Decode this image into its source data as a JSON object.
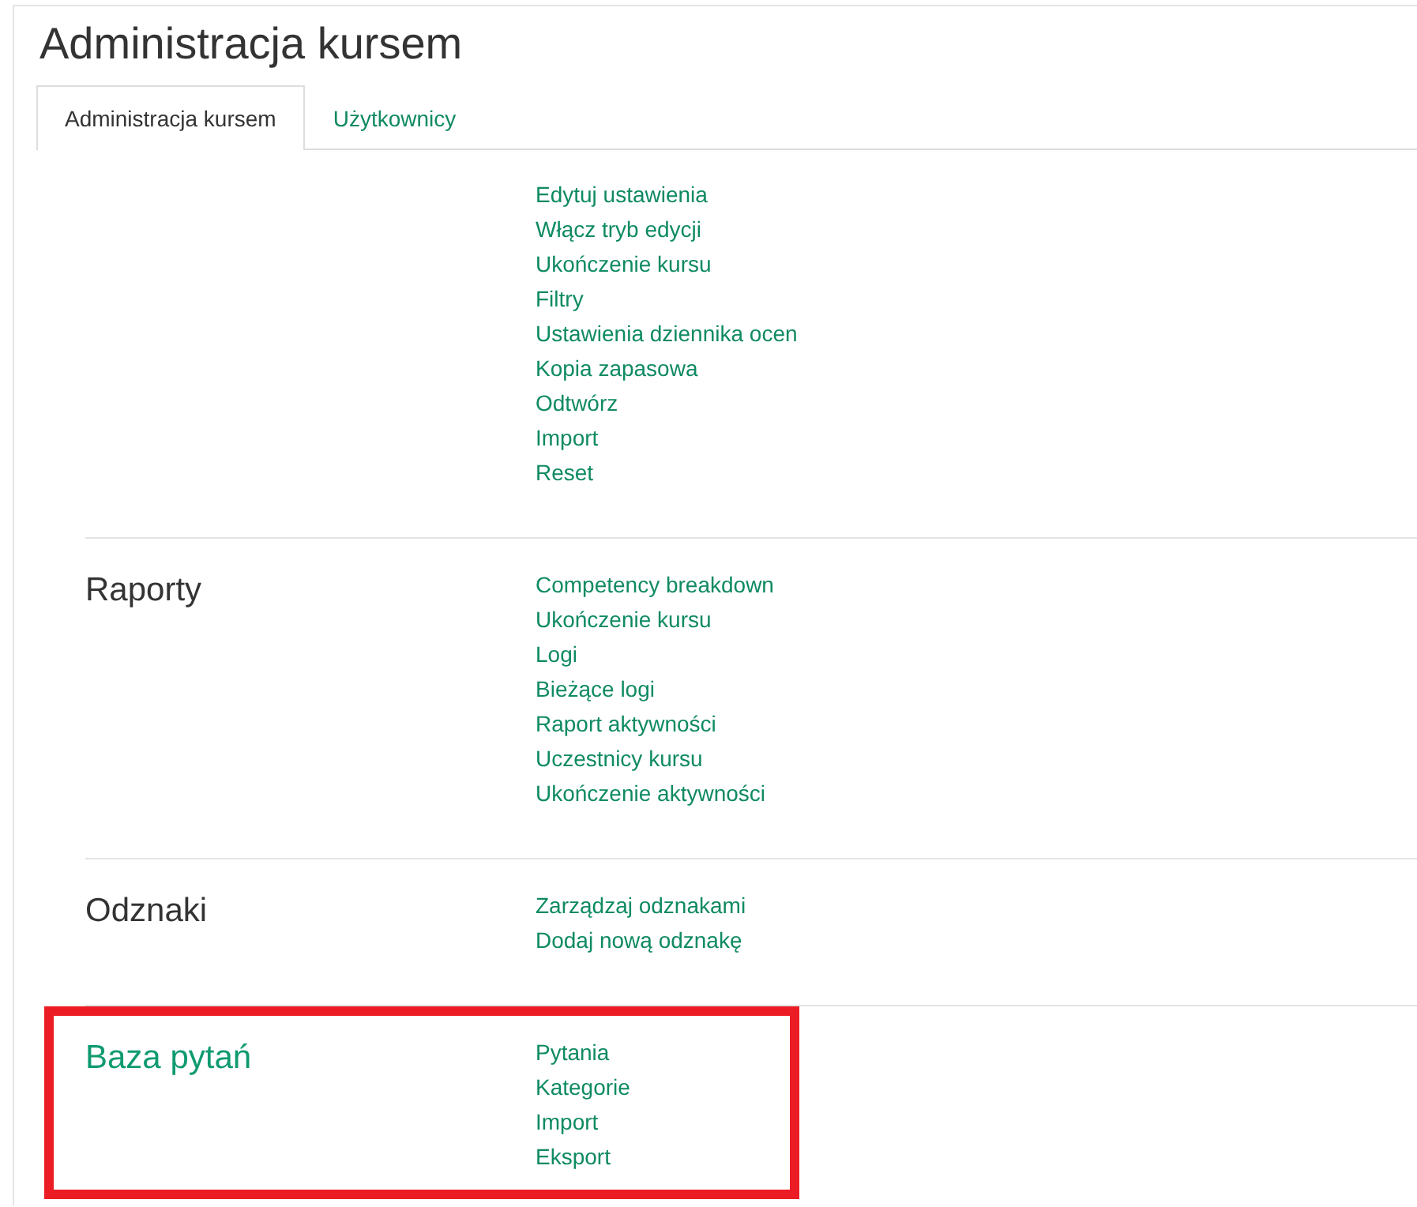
{
  "page_title": "Administracja kursem",
  "tabs": [
    {
      "label": "Administracja kursem",
      "selected": true
    },
    {
      "label": "Użytkownicy",
      "selected": false
    }
  ],
  "sections": [
    {
      "links": [
        "Edytuj ustawienia",
        "Włącz tryb edycji",
        "Ukończenie kursu",
        "Filtry",
        "Ustawienia dziennika ocen",
        "Kopia zapasowa",
        "Odtwórz",
        "Import",
        "Reset"
      ],
      "highlighted": false
    },
    {
      "heading": "Raporty",
      "heading_linked": false,
      "links": [
        "Competency breakdown",
        "Ukończenie kursu",
        "Logi",
        "Bieżące logi",
        "Raport aktywności",
        "Uczestnicy kursu",
        "Ukończenie aktywności"
      ],
      "highlighted": false
    },
    {
      "heading": "Odznaki",
      "heading_linked": false,
      "links": [
        "Zarządzaj odznakami",
        "Dodaj nową odznakę"
      ],
      "highlighted": false
    },
    {
      "heading": "Baza pytań",
      "heading_linked": true,
      "links": [
        "Pytania",
        "Kategorie",
        "Import",
        "Eksport"
      ],
      "highlighted": true
    }
  ]
}
